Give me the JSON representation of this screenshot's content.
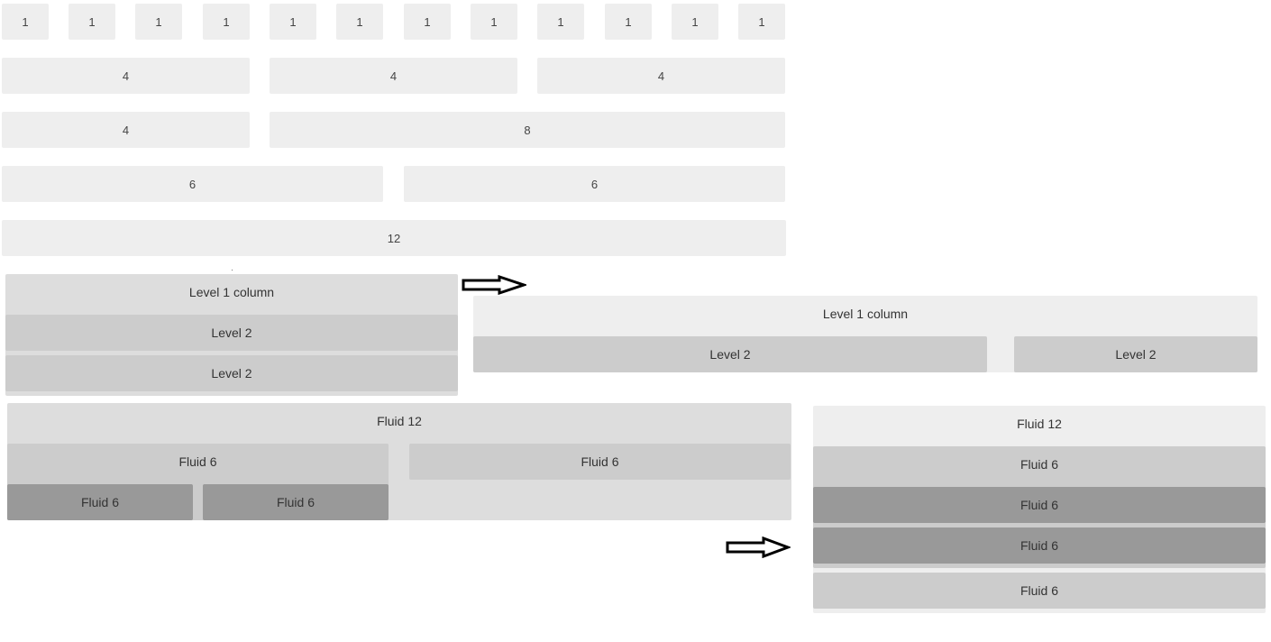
{
  "grid": {
    "row1": [
      "1",
      "1",
      "1",
      "1",
      "1",
      "1",
      "1",
      "1",
      "1",
      "1",
      "1",
      "1"
    ],
    "row2": [
      "4",
      "4",
      "4"
    ],
    "row3": [
      "4",
      "8"
    ],
    "row4": [
      "6",
      "6"
    ],
    "row5": [
      "12"
    ]
  },
  "nested_stacked": {
    "level1": "Level 1 column",
    "level2": [
      "Level 2",
      "Level 2"
    ]
  },
  "nested_side": {
    "level1": "Level 1 column",
    "level2": [
      "Level 2",
      "Level 2"
    ]
  },
  "fluid_wide": {
    "fluid12": "Fluid 12",
    "fluid6_left": "Fluid 6",
    "fluid6_right": "Fluid 6",
    "fluid6_inner": [
      "Fluid 6",
      "Fluid 6"
    ]
  },
  "fluid_stacked": {
    "fluid12": "Fluid 12",
    "items": [
      "Fluid 6",
      "Fluid 6",
      "Fluid 6",
      "Fluid 6"
    ]
  },
  "colors": {
    "grid_cell": "#eeeeee",
    "level1": "#dddddd",
    "level2": "#cccccc",
    "level3": "#999999",
    "arrow": "#000000"
  },
  "icons": [
    "right-arrow-icon",
    "right-arrow-icon"
  ]
}
